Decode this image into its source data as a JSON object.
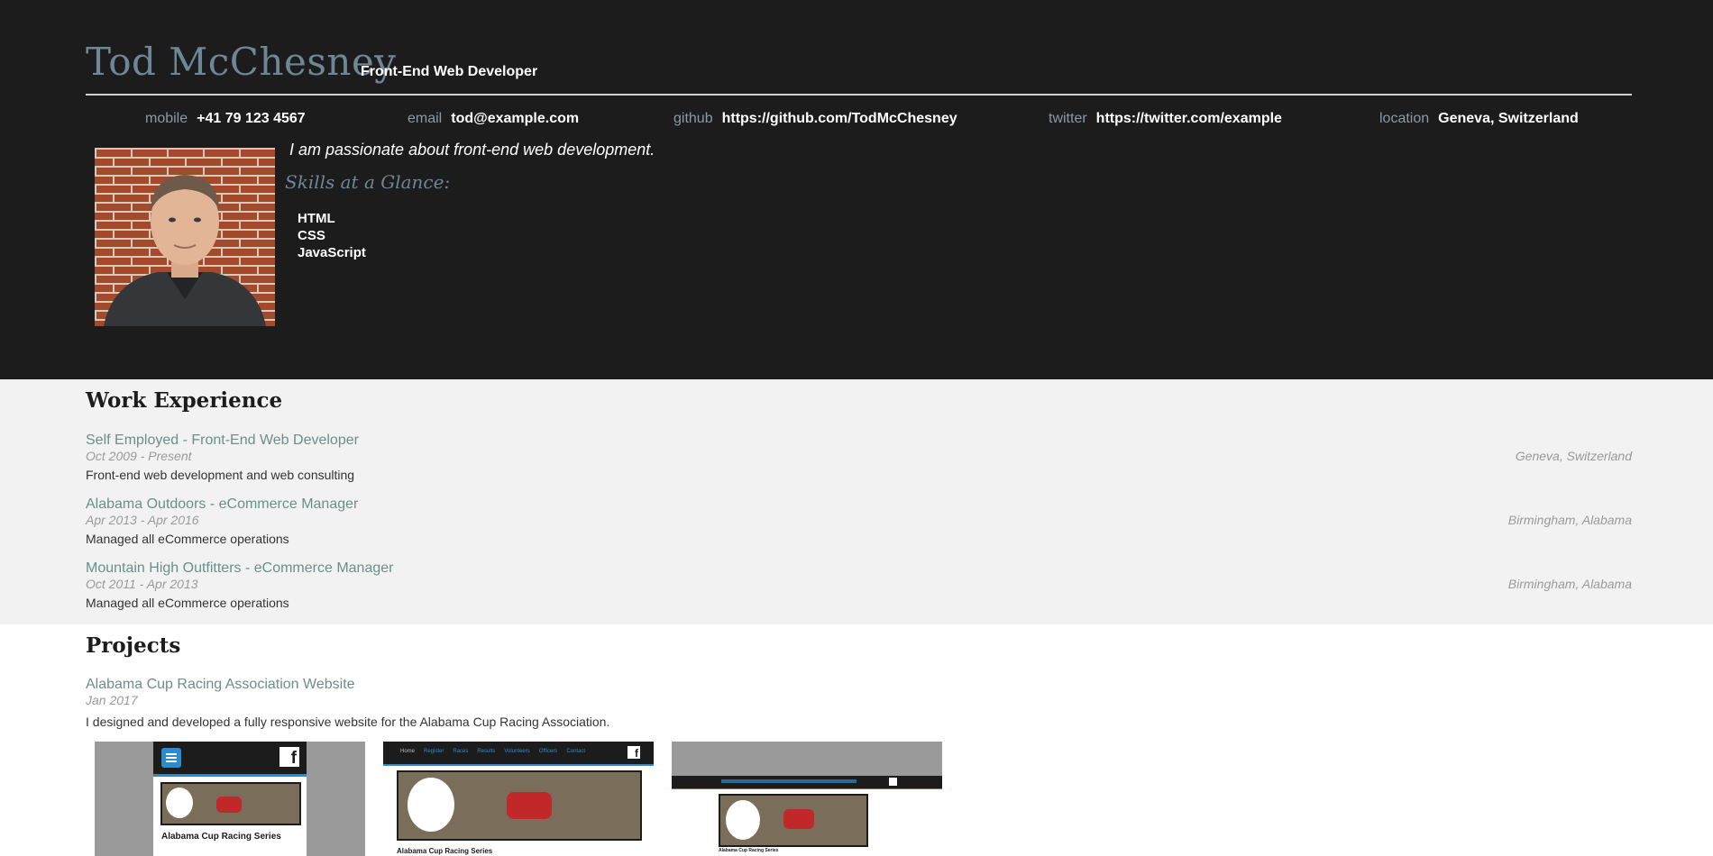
{
  "header": {
    "name": "Tod McChesney",
    "role": "Front-End Web Developer",
    "contacts": [
      {
        "label": "mobile",
        "value": "+41 79 123 4567"
      },
      {
        "label": "email",
        "value": "tod@example.com"
      },
      {
        "label": "github",
        "value": "https://github.com/TodMcChesney"
      },
      {
        "label": "twitter",
        "value": "https://twitter.com/example"
      },
      {
        "label": "location",
        "value": "Geneva, Switzerland"
      }
    ],
    "tagline": "I am passionate about front-end web development.",
    "skills_title": "Skills at a Glance:",
    "skills": [
      "HTML",
      "CSS",
      "JavaScript"
    ]
  },
  "work": {
    "title": "Work Experience",
    "jobs": [
      {
        "title": "Self Employed - Front-End Web Developer",
        "date": "Oct 2009 - Present",
        "location": "Geneva, Switzerland",
        "description": "Front-end web development and web consulting"
      },
      {
        "title": "Alabama Outdoors - eCommerce Manager",
        "date": "Apr 2013 - Apr 2016",
        "location": "Birmingham, Alabama",
        "description": "Managed all eCommerce operations"
      },
      {
        "title": "Mountain High Outfitters - eCommerce Manager",
        "date": "Oct 2011 - Apr 2013",
        "location": "Birmingham, Alabama",
        "description": "Managed all eCommerce operations"
      }
    ]
  },
  "projects": {
    "title": "Projects",
    "items": [
      {
        "title": "Alabama Cup Racing Association Website",
        "date": "Jan 2017",
        "description": "I designed and developed a fully responsive website for the Alabama Cup Racing Association.",
        "screens": {
          "mobile_heading": "Alabama Cup Racing Series",
          "desktop_nav": [
            "Home",
            "Register",
            "Races",
            "Results",
            "Volunteers",
            "Officers",
            "Contact"
          ],
          "desktop_heading": "Alabama Cup Racing Series",
          "wide_heading": "Alabama Cup Racing Series"
        }
      }
    ]
  },
  "colors": {
    "header_bg": "#1c1c1c",
    "accent": "#6e8796",
    "link": "#6b8f8a",
    "work_bg": "#f2f2f2"
  }
}
